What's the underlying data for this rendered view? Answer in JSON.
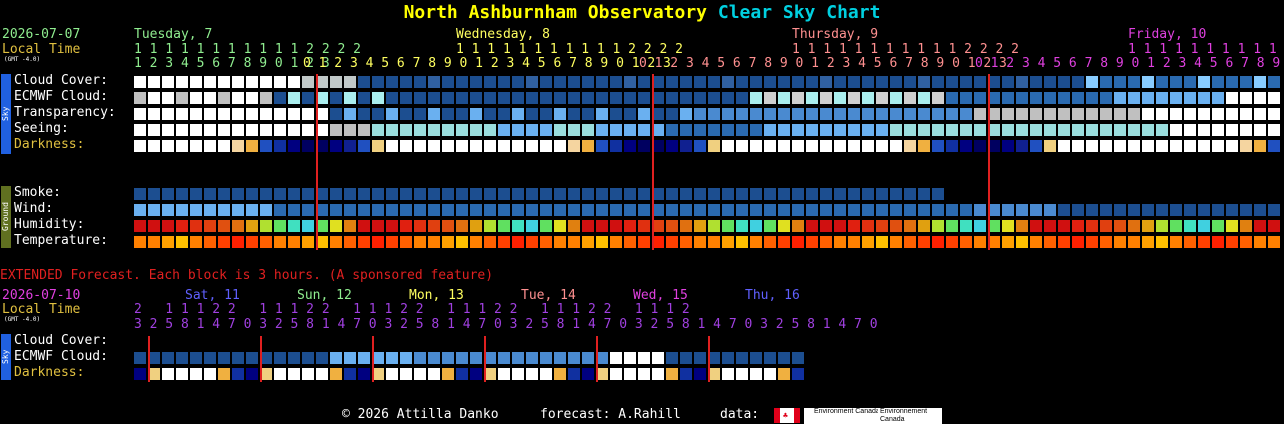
{
  "title": {
    "part1": "North Ashburnham Observatory",
    "part2": "Clear Sky Chart"
  },
  "colors": {
    "title1": "#ffff00",
    "title2": "#00d0e0"
  },
  "header": {
    "date": "2026-07-07",
    "local_time": "Local Time",
    "gmt": "(GMT -4.0)",
    "days": [
      {
        "label": "Tuesday, 7",
        "color": "#90ee90"
      },
      {
        "label": "Wednesday, 8",
        "color": "#ffff60"
      },
      {
        "label": "Thursday, 9",
        "color": "#ff9090"
      },
      {
        "label": "Friday, 10",
        "color": "#e040e0"
      }
    ],
    "hour_tens": "1 1 1 1 1 1 1 1 1 1 1 2 2 2 2",
    "hour_tens_partial": "1 1 1 1 1 1 1 1 1 1 1 1 2",
    "hour_units_first": "1 2 3 4 5 6 7 8 9 0 1 2 3",
    "hour_units_full": "0 1 2 3 4 5 6 7 8 9 0 1 2 3 4 5 6 7 8 9 0 1 2 3"
  },
  "rows": {
    "cloud": "Cloud Cover:",
    "ecmwf": "ECMWF Cloud:",
    "transparency": "Transparency:",
    "seeing": "Seeing:",
    "darkness": "Darkness:",
    "smoke": "Smoke:",
    "wind": "Wind:",
    "humidity": "Humidity:",
    "temperature": "Temperature:"
  },
  "side": {
    "sky": "Sky",
    "ground": "Ground"
  },
  "extended": {
    "banner": "EXTENDED Forecast. Each block is 3 hours. (A sponsored feature)",
    "date": "2026-07-10",
    "local_time": "Local Time",
    "gmt": "(GMT -4.0)",
    "days": [
      {
        "label": "Sat, 11",
        "color": "#6060ff"
      },
      {
        "label": "Sun, 12",
        "color": "#90ee90"
      },
      {
        "label": "Mon, 13",
        "color": "#ffff60"
      },
      {
        "label": "Tue, 14",
        "color": "#ff9090"
      },
      {
        "label": "Wed, 15",
        "color": "#e040e0"
      },
      {
        "label": "Thu, 16",
        "color": "#6060ff"
      }
    ],
    "tens": "2   1 1 1 2 2   1 1 1 2 2   1 1 1 2 2   1 1 1 2 2   1 1 1 2 2   1 1 1 2",
    "units": "3 2 5 8 1 4 7 0 3 2 5 8 1 4 7 0 3 2 5 8 1 4 7 0 3 2 5 8 1 4 7 0 3 2 5 8 1 4 7 0 3 2 5 8 1 4 7 0",
    "rows": {
      "cloud": "Cloud Cover:",
      "ecmwf": "ECMWF Cloud:",
      "darkness": "Darkness:"
    }
  },
  "footer": {
    "copyright": "© 2026 Attilla Danko",
    "forecast": "forecast: A.Rahill",
    "data": "data:",
    "logo1": "Environment Canada",
    "logo2": "Environnement Canada"
  }
}
